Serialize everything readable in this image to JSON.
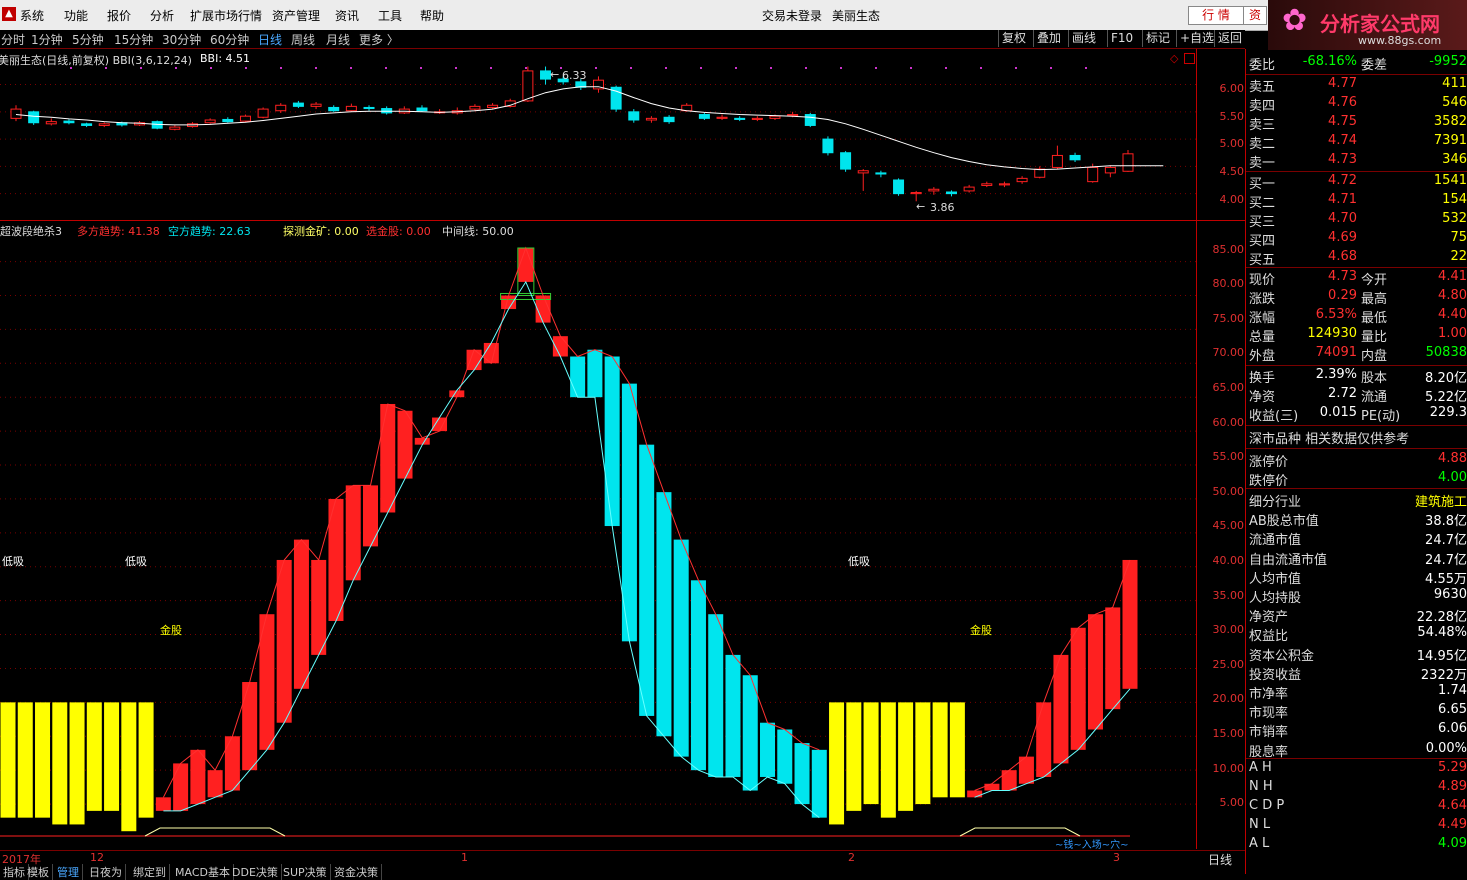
{
  "menu": {
    "items": [
      "系统",
      "功能",
      "报价",
      "分析",
      "扩展市场行情",
      "资产管理",
      "资讯",
      "工具",
      "帮助"
    ],
    "login_status": "交易未登录",
    "stock_name": "美丽生态",
    "btn_quote": "行 情",
    "btn_asset": "资"
  },
  "logo": {
    "text": "分析家公式网",
    "url_text": "www.88gs.com"
  },
  "periods": [
    "分时",
    "1分钟",
    "5分钟",
    "15分钟",
    "30分钟",
    "60分钟",
    "日线",
    "周线",
    "月线",
    "更多 〉"
  ],
  "active_period": "日线",
  "toolbar": [
    "复权",
    "叠加",
    "画线",
    "F10",
    "标记",
    "+自选",
    "返回"
  ],
  "upper": {
    "title": "美丽生态(日线,前复权) BBI(3,6,12,24)",
    "bbi_label": "BBI: 4.51",
    "high_label": "6.33",
    "low_label": "3.86",
    "y_ticks": [
      "6.00",
      "5.50",
      "5.00",
      "4.50",
      "4.00"
    ]
  },
  "lower": {
    "name": "超波段绝杀3",
    "duo_label": "多方趋势: 41.38",
    "kong_label": "空方趋势: 22.63",
    "tance_label": "探测金矿: 0.00",
    "xuanjin_label": "选金股: 0.00",
    "mid_label": "中间线: 50.00",
    "y_ticks": [
      "85.00",
      "80.00",
      "75.00",
      "70.00",
      "65.00",
      "60.00",
      "55.00",
      "50.00",
      "45.00",
      "40.00",
      "35.00",
      "30.00",
      "25.00",
      "20.00",
      "15.00",
      "10.00",
      "5.00"
    ],
    "annotations": [
      "低吸",
      "低吸",
      "低吸",
      "金股",
      "金股"
    ],
    "signal_text": "~钱~入场~穴~"
  },
  "xaxis": {
    "year": "2017年",
    "m12": "12",
    "m1": "1",
    "m2": "2",
    "m3": "3",
    "period": "日线"
  },
  "tabs": [
    "指标",
    "模板",
    "管理",
    "日夜为",
    "绑定到",
    "MACD基本",
    "DDE决策",
    "SUP决策",
    "资金决策"
  ],
  "right_panel": {
    "weibi": {
      "label": "委比",
      "value": "-68.16%",
      "label2": "委差",
      "value2": "-9952"
    },
    "sells": [
      {
        "label": "卖五",
        "price": "4.77",
        "vol": "411"
      },
      {
        "label": "卖四",
        "price": "4.76",
        "vol": "546"
      },
      {
        "label": "卖三",
        "price": "4.75",
        "vol": "3582"
      },
      {
        "label": "卖二",
        "price": "4.74",
        "vol": "7391"
      },
      {
        "label": "卖一",
        "price": "4.73",
        "vol": "346"
      }
    ],
    "buys": [
      {
        "label": "买一",
        "price": "4.72",
        "vol": "1541"
      },
      {
        "label": "买二",
        "price": "4.71",
        "vol": "154"
      },
      {
        "label": "买三",
        "price": "4.70",
        "vol": "532"
      },
      {
        "label": "买四",
        "price": "4.69",
        "vol": "75"
      },
      {
        "label": "买五",
        "price": "4.68",
        "vol": "22"
      }
    ],
    "quote": [
      {
        "k": "现价",
        "v": "4.73",
        "k2": "今开",
        "v2": "4.41"
      },
      {
        "k": "涨跌",
        "v": "0.29",
        "k2": "最高",
        "v2": "4.80"
      },
      {
        "k": "涨幅",
        "v": "6.53%",
        "k2": "最低",
        "v2": "4.40"
      },
      {
        "k": "总量",
        "v": "124930",
        "k2": "量比",
        "v2": "1.00"
      },
      {
        "k": "外盘",
        "v": "74091",
        "k2": "内盘",
        "v2": "50838"
      }
    ],
    "fin": [
      {
        "k": "换手",
        "v": "2.39%",
        "k2": "股本",
        "v2": "8.20亿"
      },
      {
        "k": "净资",
        "v": "2.72",
        "k2": "流通",
        "v2": "5.22亿"
      },
      {
        "k": "收益(三)",
        "v": "0.015",
        "k2": "PE(动)",
        "v2": "229.3"
      }
    ],
    "market_note": "深市品种  相关数据仅供参考",
    "limits": [
      {
        "k": "涨停价",
        "v": "4.88"
      },
      {
        "k": "跌停价",
        "v": "4.00"
      }
    ],
    "detail": [
      {
        "k": "细分行业",
        "v": "建筑施工"
      },
      {
        "k": "AB股总市值",
        "v": "38.8亿"
      },
      {
        "k": "流通市值",
        "v": "24.7亿"
      },
      {
        "k": "自由流通市值",
        "v": "24.7亿"
      },
      {
        "k": "人均市值",
        "v": "4.55万"
      },
      {
        "k": "人均持股",
        "v": "9630"
      },
      {
        "k": "净资产",
        "v": "22.28亿"
      },
      {
        "k": "权益比",
        "v": "54.48%"
      },
      {
        "k": "资本公积金",
        "v": "14.95亿"
      },
      {
        "k": "投资收益",
        "v": "2322万"
      },
      {
        "k": "市净率",
        "v": "1.74"
      },
      {
        "k": "市现率",
        "v": "6.65"
      },
      {
        "k": "市销率",
        "v": "6.06"
      },
      {
        "k": "股息率",
        "v": "0.00%"
      }
    ],
    "indices": [
      {
        "k": "A H",
        "v": "5.29"
      },
      {
        "k": "N H",
        "v": "4.89"
      },
      {
        "k": "C D P",
        "v": "4.64"
      },
      {
        "k": "N L",
        "v": "4.49"
      },
      {
        "k": "A L",
        "v": "4.09"
      }
    ]
  },
  "colors": {
    "up": "#ff2020",
    "down": "#00e5ee",
    "yellow": "#ffff00",
    "bg": "#000000",
    "grid": "#7a0000"
  },
  "chart_data": [
    {
      "type": "candlestick",
      "title": "美丽生态(日线,前复权) BBI(3,6,12,24)",
      "ylim": [
        3.7,
        6.45
      ],
      "candles": [
        {
          "o": 5.38,
          "c": 5.55,
          "h": 5.62,
          "l": 5.33
        },
        {
          "o": 5.5,
          "c": 5.3,
          "h": 5.52,
          "l": 5.26
        },
        {
          "o": 5.28,
          "c": 5.32,
          "h": 5.38,
          "l": 5.25
        },
        {
          "o": 5.33,
          "c": 5.3,
          "h": 5.36,
          "l": 5.27
        },
        {
          "o": 5.28,
          "c": 5.25,
          "h": 5.3,
          "l": 5.22
        },
        {
          "o": 5.25,
          "c": 5.28,
          "h": 5.31,
          "l": 5.22
        },
        {
          "o": 5.3,
          "c": 5.26,
          "h": 5.32,
          "l": 5.23
        },
        {
          "o": 5.26,
          "c": 5.3,
          "h": 5.33,
          "l": 5.24
        },
        {
          "o": 5.32,
          "c": 5.2,
          "h": 5.34,
          "l": 5.18
        },
        {
          "o": 5.18,
          "c": 5.22,
          "h": 5.25,
          "l": 5.16
        },
        {
          "o": 5.23,
          "c": 5.28,
          "h": 5.31,
          "l": 5.21
        },
        {
          "o": 5.3,
          "c": 5.35,
          "h": 5.38,
          "l": 5.28
        },
        {
          "o": 5.36,
          "c": 5.32,
          "h": 5.4,
          "l": 5.3
        },
        {
          "o": 5.33,
          "c": 5.42,
          "h": 5.45,
          "l": 5.31
        },
        {
          "o": 5.4,
          "c": 5.55,
          "h": 5.58,
          "l": 5.38
        },
        {
          "o": 5.52,
          "c": 5.62,
          "h": 5.66,
          "l": 5.48
        },
        {
          "o": 5.66,
          "c": 5.6,
          "h": 5.7,
          "l": 5.57
        },
        {
          "o": 5.6,
          "c": 5.64,
          "h": 5.68,
          "l": 5.55
        },
        {
          "o": 5.58,
          "c": 5.52,
          "h": 5.62,
          "l": 5.5
        },
        {
          "o": 5.52,
          "c": 5.6,
          "h": 5.65,
          "l": 5.5
        },
        {
          "o": 5.58,
          "c": 5.56,
          "h": 5.62,
          "l": 5.52
        },
        {
          "o": 5.56,
          "c": 5.48,
          "h": 5.6,
          "l": 5.45
        },
        {
          "o": 5.48,
          "c": 5.55,
          "h": 5.6,
          "l": 5.46
        },
        {
          "o": 5.57,
          "c": 5.52,
          "h": 5.62,
          "l": 5.5
        },
        {
          "o": 5.5,
          "c": 5.5,
          "h": 5.55,
          "l": 5.46
        },
        {
          "o": 5.48,
          "c": 5.52,
          "h": 5.58,
          "l": 5.45
        },
        {
          "o": 5.55,
          "c": 5.6,
          "h": 5.64,
          "l": 5.52
        },
        {
          "o": 5.58,
          "c": 5.62,
          "h": 5.66,
          "l": 5.55
        },
        {
          "o": 5.6,
          "c": 5.7,
          "h": 5.74,
          "l": 5.58
        },
        {
          "o": 5.7,
          "c": 6.25,
          "h": 6.33,
          "l": 5.68
        },
        {
          "o": 6.25,
          "c": 6.1,
          "h": 6.33,
          "l": 6.0
        },
        {
          "o": 6.1,
          "c": 6.05,
          "h": 6.15,
          "l": 6.0
        },
        {
          "o": 6.05,
          "c": 5.95,
          "h": 6.1,
          "l": 5.9
        },
        {
          "o": 5.92,
          "c": 6.08,
          "h": 6.15,
          "l": 5.85
        },
        {
          "o": 5.95,
          "c": 5.55,
          "h": 5.98,
          "l": 5.5
        },
        {
          "o": 5.5,
          "c": 5.35,
          "h": 5.55,
          "l": 5.3
        },
        {
          "o": 5.35,
          "c": 5.38,
          "h": 5.42,
          "l": 5.3
        },
        {
          "o": 5.4,
          "c": 5.32,
          "h": 5.44,
          "l": 5.28
        },
        {
          "o": 5.52,
          "c": 5.62,
          "h": 5.66,
          "l": 5.5
        },
        {
          "o": 5.45,
          "c": 5.38,
          "h": 5.48,
          "l": 5.35
        },
        {
          "o": 5.38,
          "c": 5.4,
          "h": 5.45,
          "l": 5.35
        },
        {
          "o": 5.38,
          "c": 5.36,
          "h": 5.42,
          "l": 5.33
        },
        {
          "o": 5.36,
          "c": 5.38,
          "h": 5.42,
          "l": 5.33
        },
        {
          "o": 5.38,
          "c": 5.42,
          "h": 5.45,
          "l": 5.35
        },
        {
          "o": 5.43,
          "c": 5.45,
          "h": 5.5,
          "l": 5.4
        },
        {
          "o": 5.45,
          "c": 5.25,
          "h": 5.48,
          "l": 5.22
        },
        {
          "o": 5.0,
          "c": 4.75,
          "h": 5.05,
          "l": 4.7
        },
        {
          "o": 4.75,
          "c": 4.45,
          "h": 4.78,
          "l": 4.4
        },
        {
          "o": 4.38,
          "c": 4.42,
          "h": 4.45,
          "l": 4.05
        },
        {
          "o": 4.38,
          "c": 4.36,
          "h": 4.42,
          "l": 4.3
        },
        {
          "o": 4.25,
          "c": 4.0,
          "h": 4.28,
          "l": 3.96
        },
        {
          "o": 4.0,
          "c": 4.02,
          "h": 4.05,
          "l": 3.86
        },
        {
          "o": 4.05,
          "c": 4.08,
          "h": 4.12,
          "l": 3.98
        },
        {
          "o": 4.03,
          "c": 4.0,
          "h": 4.06,
          "l": 3.95
        },
        {
          "o": 4.05,
          "c": 4.12,
          "h": 4.16,
          "l": 4.02
        },
        {
          "o": 4.15,
          "c": 4.18,
          "h": 4.22,
          "l": 4.12
        },
        {
          "o": 4.16,
          "c": 4.18,
          "h": 4.22,
          "l": 4.12
        },
        {
          "o": 4.22,
          "c": 4.28,
          "h": 4.32,
          "l": 4.18
        },
        {
          "o": 4.3,
          "c": 4.45,
          "h": 4.5,
          "l": 4.28
        },
        {
          "o": 4.48,
          "c": 4.7,
          "h": 4.88,
          "l": 4.45
        },
        {
          "o": 4.7,
          "c": 4.62,
          "h": 4.75,
          "l": 4.58
        },
        {
          "o": 4.22,
          "c": 4.48,
          "h": 4.55,
          "l": 4.2
        },
        {
          "o": 4.38,
          "c": 4.48,
          "h": 4.52,
          "l": 4.3
        },
        {
          "o": 4.41,
          "c": 4.73,
          "h": 4.8,
          "l": 4.4
        }
      ],
      "bbi": [
        5.45,
        5.42,
        5.4,
        5.37,
        5.35,
        5.32,
        5.3,
        5.29,
        5.27,
        5.26,
        5.26,
        5.27,
        5.29,
        5.31,
        5.34,
        5.38,
        5.42,
        5.46,
        5.48,
        5.5,
        5.51,
        5.51,
        5.51,
        5.5,
        5.49,
        5.5,
        5.52,
        5.55,
        5.62,
        5.74,
        5.85,
        5.92,
        5.96,
        5.96,
        5.88,
        5.76,
        5.65,
        5.57,
        5.52,
        5.49,
        5.47,
        5.45,
        5.44,
        5.43,
        5.42,
        5.4,
        5.36,
        5.28,
        5.18,
        5.07,
        4.96,
        4.85,
        4.75,
        4.66,
        4.59,
        4.53,
        4.49,
        4.46,
        4.44,
        4.45,
        4.47,
        4.49,
        4.51,
        4.51,
        4.51,
        4.51
      ]
    },
    {
      "type": "bar",
      "title": "超波段绝杀3",
      "ylim": [
        0,
        87
      ],
      "bars": [
        {
          "c": "yellow",
          "b": 3,
          "t": 20
        },
        {
          "c": "yellow",
          "b": 3,
          "t": 20
        },
        {
          "c": "yellow",
          "b": 3,
          "t": 20
        },
        {
          "c": "yellow",
          "b": 2,
          "t": 20
        },
        {
          "c": "yellow",
          "b": 2,
          "t": 20
        },
        {
          "c": "yellow",
          "b": 4,
          "t": 20
        },
        {
          "c": "yellow",
          "b": 4,
          "t": 20
        },
        {
          "c": "yellow",
          "b": 1,
          "t": 20
        },
        {
          "c": "yellow",
          "b": 3,
          "t": 20
        },
        {
          "c": "red",
          "b": 4,
          "t": 6
        },
        {
          "c": "red",
          "b": 4,
          "t": 11
        },
        {
          "c": "red",
          "b": 5,
          "t": 13
        },
        {
          "c": "red",
          "b": 6,
          "t": 10
        },
        {
          "c": "red",
          "b": 7,
          "t": 15
        },
        {
          "c": "red",
          "b": 10,
          "t": 23
        },
        {
          "c": "red",
          "b": 13,
          "t": 33
        },
        {
          "c": "red",
          "b": 17,
          "t": 41
        },
        {
          "c": "red",
          "b": 22,
          "t": 44
        },
        {
          "c": "red",
          "b": 27,
          "t": 41
        },
        {
          "c": "red",
          "b": 32,
          "t": 50
        },
        {
          "c": "red",
          "b": 38,
          "t": 52
        },
        {
          "c": "red",
          "b": 43,
          "t": 52
        },
        {
          "c": "red",
          "b": 48,
          "t": 64
        },
        {
          "c": "red",
          "b": 53,
          "t": 63
        },
        {
          "c": "red",
          "b": 58,
          "t": 59
        },
        {
          "c": "red",
          "b": 62,
          "t": 60
        },
        {
          "c": "red",
          "b": 66,
          "t": 65
        },
        {
          "c": "red",
          "b": 69,
          "t": 72
        },
        {
          "c": "red",
          "b": 73,
          "t": 70
        },
        {
          "c": "red",
          "b": 78,
          "t": 80
        },
        {
          "c": "red",
          "b": 82,
          "t": 87
        },
        {
          "c": "red",
          "b": 76,
          "t": 80
        },
        {
          "c": "red",
          "b": 71,
          "t": 74
        },
        {
          "c": "cyan",
          "b": 65,
          "t": 71
        },
        {
          "c": "cyan",
          "b": 65,
          "t": 72
        },
        {
          "c": "cyan",
          "b": 46,
          "t": 71
        },
        {
          "c": "cyan",
          "b": 29,
          "t": 67
        },
        {
          "c": "cyan",
          "b": 18,
          "t": 58
        },
        {
          "c": "cyan",
          "b": 15,
          "t": 51
        },
        {
          "c": "cyan",
          "b": 12,
          "t": 44
        },
        {
          "c": "cyan",
          "b": 10,
          "t": 38
        },
        {
          "c": "cyan",
          "b": 9,
          "t": 33
        },
        {
          "c": "cyan",
          "b": 9,
          "t": 27
        },
        {
          "c": "cyan",
          "b": 7,
          "t": 24
        },
        {
          "c": "cyan",
          "b": 9,
          "t": 17
        },
        {
          "c": "cyan",
          "b": 8,
          "t": 16
        },
        {
          "c": "cyan",
          "b": 5,
          "t": 14
        },
        {
          "c": "cyan",
          "b": 3,
          "t": 13
        },
        {
          "c": "yellow",
          "b": 2,
          "t": 20
        },
        {
          "c": "yellow",
          "b": 4,
          "t": 20
        },
        {
          "c": "yellow",
          "b": 5,
          "t": 20
        },
        {
          "c": "yellow",
          "b": 3,
          "t": 20
        },
        {
          "c": "yellow",
          "b": 4,
          "t": 20
        },
        {
          "c": "yellow",
          "b": 5,
          "t": 20
        },
        {
          "c": "yellow",
          "b": 6,
          "t": 20
        },
        {
          "c": "yellow",
          "b": 6,
          "t": 20
        },
        {
          "c": "red",
          "b": 6,
          "t": 7
        },
        {
          "c": "red",
          "b": 7,
          "t": 8
        },
        {
          "c": "red",
          "b": 7,
          "t": 10
        },
        {
          "c": "red",
          "b": 8,
          "t": 12
        },
        {
          "c": "red",
          "b": 9,
          "t": 20
        },
        {
          "c": "red",
          "b": 11,
          "t": 27
        },
        {
          "c": "red",
          "b": 13,
          "t": 31
        },
        {
          "c": "red",
          "b": 16,
          "t": 33
        },
        {
          "c": "red",
          "b": 19,
          "t": 34
        },
        {
          "c": "red",
          "b": 22,
          "t": 41
        }
      ]
    }
  ]
}
